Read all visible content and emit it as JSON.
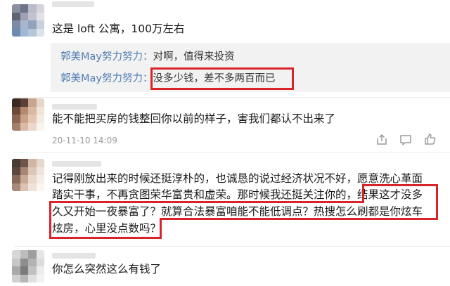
{
  "comments": [
    {
      "text": "这是 loft 公寓，100万左右",
      "replies": [
        {
          "user": "郭美May努力努力：",
          "text": "对啊，值得来投资"
        },
        {
          "user": "郭美May努力努力：",
          "text": "没多少钱，差不多两百而已"
        }
      ]
    },
    {
      "text": "能不能把买房的钱整回你以前的样子，害我们都认不出来了",
      "time": "20-11-10 14:09"
    },
    {
      "lines": [
        "记得刚放出来的时候还挺淳朴的，也诚恳的说过经济状况不好，愿意洗心革面",
        "踏实干事，不再贪图荣华富贵和虚荣。那时候我还挺关注你的，结果这才没多",
        "久又开始一夜暴富了？就算合法暴富咱能不能低调点？热搜怎么刷都是你炫车",
        "炫房，心里没点数吗？"
      ]
    },
    {
      "text": "你怎么突然这么有钱了"
    }
  ],
  "colors": {
    "accent_user": "#4f7cb3",
    "highlight_red": "#d8232a",
    "reply_bg": "#f2f2f2",
    "meta_gray": "#9a9a9a"
  },
  "icons": [
    "share-icon",
    "comment-icon",
    "like-icon"
  ]
}
